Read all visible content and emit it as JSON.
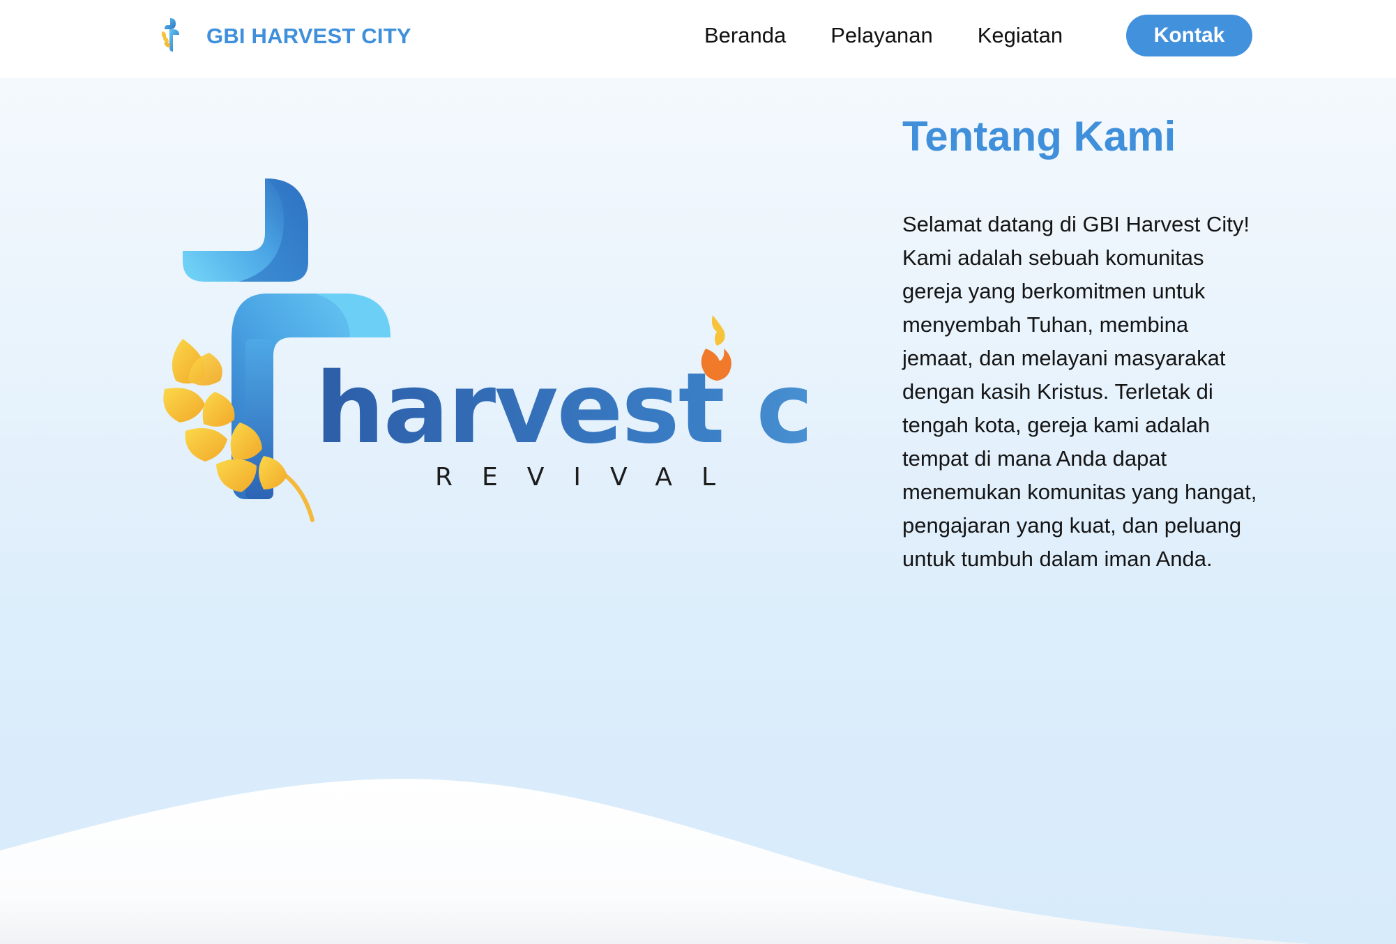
{
  "navbar": {
    "brand_name": "GBI HARVEST CITY",
    "brand_icon": "cross-wheat-logo-icon",
    "links": [
      {
        "label": "Beranda"
      },
      {
        "label": "Pelayanan"
      },
      {
        "label": "Kegiatan"
      }
    ],
    "cta_label": "Kontak"
  },
  "hero": {
    "logo": {
      "wordmark": "harvest city",
      "tagline": "REVIVAL",
      "icons": [
        "cross-icon",
        "wheat-icon",
        "flame-icon"
      ]
    }
  },
  "about": {
    "title": "Tentang Kami",
    "body": "Selamat datang di GBI Harvest City! Kami adalah sebuah komunitas gereja yang berkomitmen untuk menyembah Tuhan, membina jemaat, dan melayani masyarakat dengan kasih Kristus. Terletak di tengah kota, gereja kami adalah tempat di mana Anda dapat menemukan komunitas yang hangat, pengajaran yang kuat, dan peluang untuk tumbuh dalam iman Anda."
  },
  "colors": {
    "brand_blue": "#3f8fdb",
    "button_blue": "#4291dd",
    "text_dark": "#141414",
    "wheat_yellow": "#f6c33a",
    "flame_orange": "#f0792a",
    "background_light_blue": "#dcedfb"
  }
}
